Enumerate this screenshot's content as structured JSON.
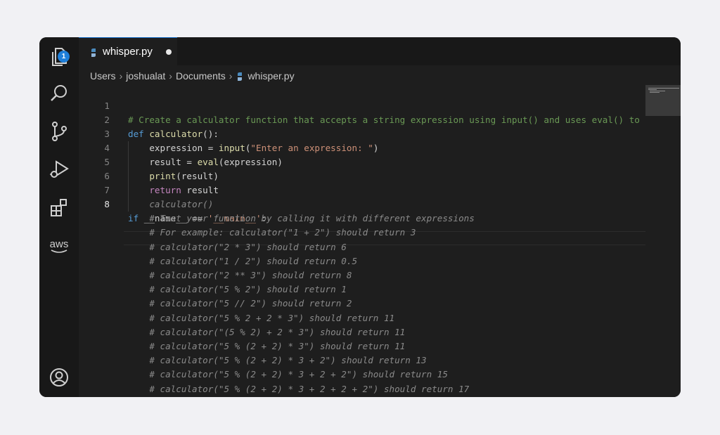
{
  "tab": {
    "filename": "whisper.py",
    "icon": "python-icon",
    "modified": true
  },
  "activity_bar": {
    "items": [
      {
        "name": "explorer-icon",
        "badge": "1"
      },
      {
        "name": "search-icon"
      },
      {
        "name": "source-control-icon"
      },
      {
        "name": "run-debug-icon"
      },
      {
        "name": "extensions-icon"
      },
      {
        "name": "aws-icon",
        "label": "aws"
      }
    ],
    "account": {
      "name": "account-icon"
    }
  },
  "breadcrumb": {
    "parts": [
      "Users",
      "joshualat",
      "Documents",
      "whisper.py"
    ]
  },
  "editor": {
    "lines": [
      {
        "num": "1",
        "text": "# Create a calculator function that accepts a string expression using input() and uses eval() to eva"
      },
      {
        "num": "2",
        "text": "def calculator():"
      },
      {
        "num": "3",
        "text": "    expression = input(\"Enter an expression: \")"
      },
      {
        "num": "4",
        "text": "    result = eval(expression)"
      },
      {
        "num": "5",
        "text": "    print(result)"
      },
      {
        "num": "6",
        "text": "    return result"
      },
      {
        "num": "7",
        "text": ""
      },
      {
        "num": "8",
        "text": "if __name__ == '__main__':"
      }
    ],
    "ghost_lines": [
      "    calculator()",
      "    # Test your function by calling it with different expressions",
      "    # For example: calculator(\"1 + 2\") should return 3",
      "    # calculator(\"2 * 3\") should return 6",
      "    # calculator(\"1 / 2\") should return 0.5",
      "    # calculator(\"2 ** 3\") should return 8",
      "    # calculator(\"5 % 2\") should return 1",
      "    # calculator(\"5 // 2\") should return 2",
      "    # calculator(\"5 % 2 + 2 * 3\") should return 11",
      "    # calculator(\"(5 % 2) + 2 * 3\") should return 11",
      "    # calculator(\"5 % (2 + 2) * 3\") should return 11",
      "    # calculator(\"5 % (2 + 2) * 3 + 2\") should return 13",
      "    # calculator(\"5 % (2 + 2) * 3 + 2 + 2\") should return 15",
      "    # calculator(\"5 % (2 + 2) * 3 + 2 + 2 + 2\") should return 17"
    ]
  }
}
